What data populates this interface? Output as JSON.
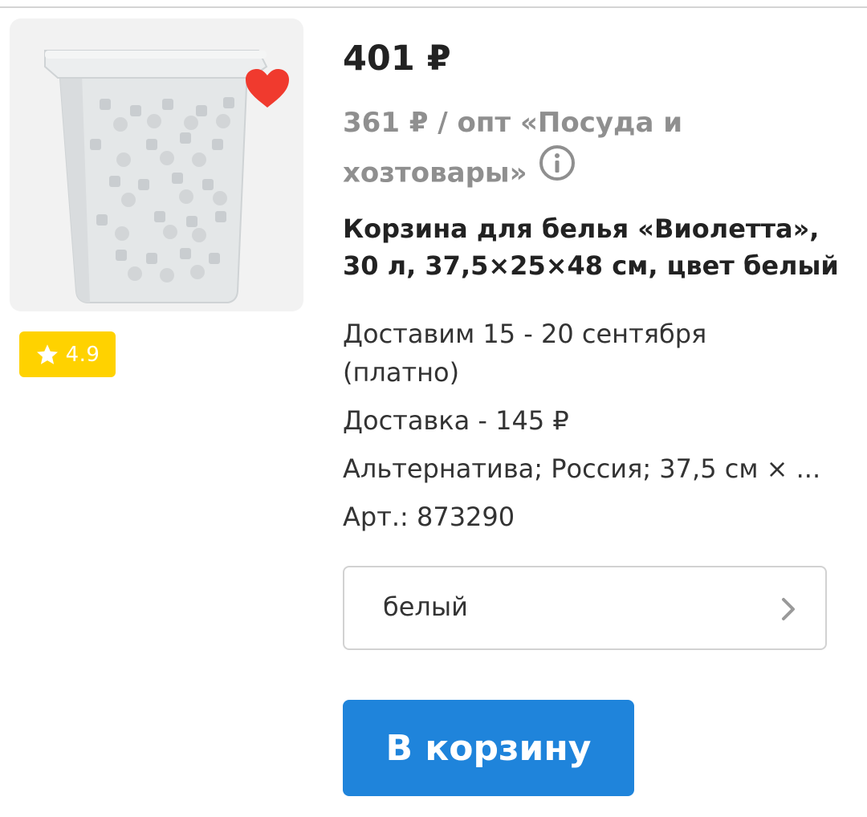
{
  "product": {
    "price": "401 ₽",
    "wholesale_price": "361 ₽ / опт «Посуда и хозтовары»",
    "title": "Корзина для белья «Виолетта», 30 л, 37,5×25×48 см, цвет белый",
    "rating": "4.9",
    "image_alt": "Корзина для белья «Виолетта»",
    "favorite": true,
    "icons": {
      "favorite": "heart-icon",
      "rating": "star-icon",
      "info": "info-icon",
      "variant": "chevron-right-icon"
    }
  },
  "details": {
    "delivery": "Доставим 15 - 20 сентября (платно)",
    "delivery_cost": "Доставка - 145 ₽",
    "attributes": "Альтернатива; Россия; 37,5 см × ...",
    "article": "Арт.: 873290"
  },
  "variant": {
    "selected": "белый"
  },
  "actions": {
    "add_to_cart": "В корзину"
  },
  "colors": {
    "accent": "#1f84db",
    "favorite": "#f03a2e",
    "rating_badge": "#ffd200",
    "muted_text": "#8f8f8f"
  }
}
